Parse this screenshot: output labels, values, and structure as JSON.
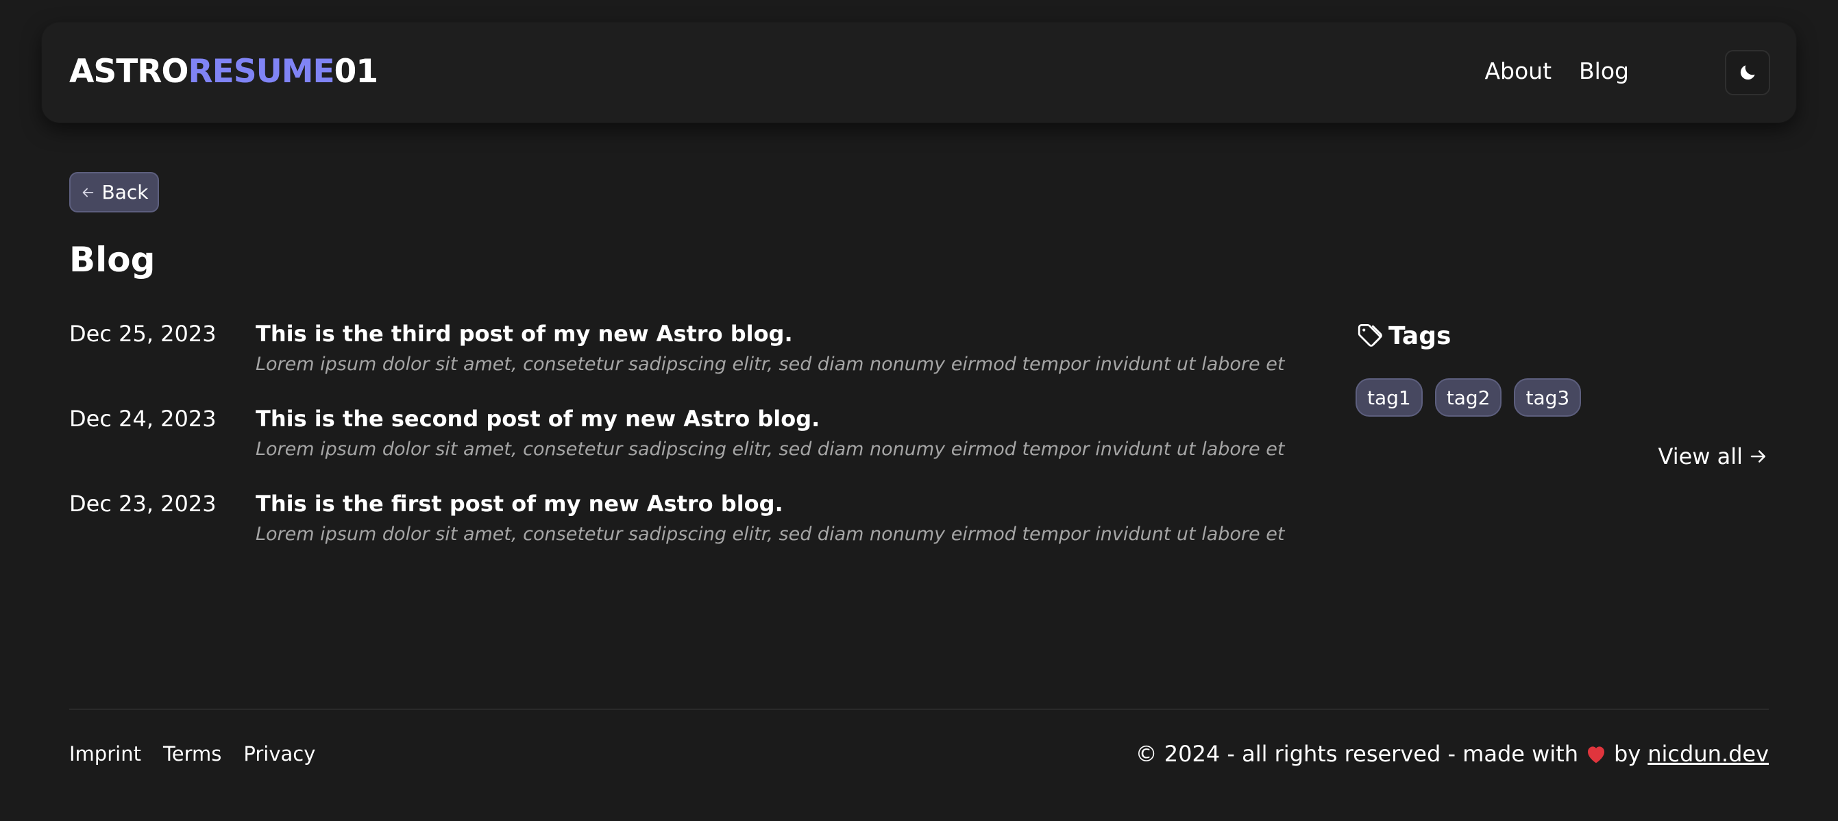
{
  "header": {
    "logo": {
      "part1": "ASTRO",
      "part2": "RESUME",
      "part3": "01"
    },
    "nav": [
      {
        "label": "About"
      },
      {
        "label": "Blog"
      }
    ],
    "theme_icon": "moon-icon"
  },
  "back": {
    "label": "Back",
    "icon": "arrow-left-icon"
  },
  "page": {
    "title": "Blog"
  },
  "posts": [
    {
      "date": "Dec 25, 2023",
      "title": "This is the third post of my new Astro blog.",
      "excerpt": "Lorem ipsum dolor sit amet, consetetur sadipscing elitr, sed diam nonumy eirmod tempor invidunt ut labore et"
    },
    {
      "date": "Dec 24, 2023",
      "title": "This is the second post of my new Astro blog.",
      "excerpt": "Lorem ipsum dolor sit amet, consetetur sadipscing elitr, sed diam nonumy eirmod tempor invidunt ut labore et"
    },
    {
      "date": "Dec 23, 2023",
      "title": "This is the first post of my new Astro blog.",
      "excerpt": "Lorem ipsum dolor sit amet, consetetur sadipscing elitr, sed diam nonumy eirmod tempor invidunt ut labore et"
    }
  ],
  "tags": {
    "heading": "Tags",
    "icon": "tag-icon",
    "items": [
      {
        "label": "tag1"
      },
      {
        "label": "tag2"
      },
      {
        "label": "tag3"
      }
    ],
    "view_all": "View all",
    "view_all_icon": "arrow-right-icon"
  },
  "footer": {
    "links": [
      {
        "label": "Imprint"
      },
      {
        "label": "Terms"
      },
      {
        "label": "Privacy"
      }
    ],
    "copyright_prefix": "© 2024 - all rights reserved - made with",
    "heart_icon": "heart-icon",
    "by": "by",
    "author_link": "nicdun.dev"
  },
  "colors": {
    "background": "#1b1b1b",
    "header_bg": "#1e1e1e",
    "accent": "#8084f5",
    "tag_bg": "#474860",
    "tag_border": "#5d5f7e",
    "muted_text": "#a5a5a5",
    "heart": "#e0353d"
  }
}
